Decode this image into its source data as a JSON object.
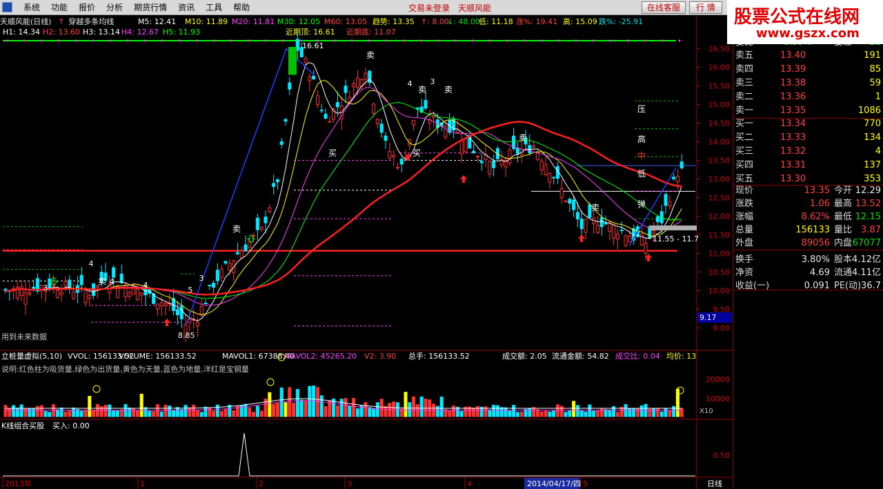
{
  "menubar": {
    "items": [
      "系统",
      "功能",
      "报价",
      "分析",
      "期货行情",
      "资讯",
      "工具",
      "帮助"
    ],
    "login_status": "交易未登录",
    "brand": "天顺风能",
    "btn_service": "在线客服",
    "btn_quote": "行 情"
  },
  "watermark": {
    "title": "股票公式在线网",
    "url": "www.gszx.com"
  },
  "header": {
    "stock": "天顺风能(日线)",
    "indicator_name": "穿越多条均线",
    "ma": [
      {
        "label": "M5: 12.41",
        "color": "#ffffff"
      },
      {
        "label": "M10: 11.89",
        "color": "#ffff00"
      },
      {
        "label": "M20: 11.81",
        "color": "#ff40ff"
      },
      {
        "label": "M30: 12.05",
        "color": "#00ff00"
      },
      {
        "label": "M60: 13.05",
        "color": "#ff4040"
      }
    ],
    "trend": {
      "label": "趋势: 13.35",
      "color": "#ffff00"
    },
    "extra": [
      {
        "label": "↑: 8.00",
        "color": "#ff4040"
      },
      {
        "label": "↓: 48.00",
        "color": "#00e000"
      },
      {
        "label": "低: 11.18",
        "color": "#ffff00"
      },
      {
        "label": "涨%: 19.41",
        "color": "#ff4040"
      },
      {
        "label": "高: 15.09",
        "color": "#ffff00"
      },
      {
        "label": "跌%: -25.91",
        "color": "#00e0e0"
      }
    ],
    "h_levels": [
      {
        "label": "H1: 14.34",
        "color": "#ffffff"
      },
      {
        "label": "H2: 13.60",
        "color": "#ff4040"
      },
      {
        "label": "H3: 13.14",
        "color": "#ffffff"
      },
      {
        "label": "H4: 12.67",
        "color": "#ff40ff"
      },
      {
        "label": "H5: 11.93",
        "color": "#00ff00"
      }
    ],
    "recent_top": "近期顶: 16.61",
    "recent_bottom": "近期底: 11.07"
  },
  "chart_data": {
    "type": "candlestick",
    "price_axis": {
      "ticks": [
        "16.50",
        "16.00",
        "15.50",
        "15.00",
        "14.50",
        "14.00",
        "13.50",
        "13.00",
        "12.50",
        "12.00",
        "11.50",
        "11.00",
        "10.50",
        "10.00",
        "9.50",
        "9.00"
      ],
      "min": 8.95,
      "max": 16.68
    },
    "current_price_label": "9.17",
    "top_label": "16.61",
    "bottom_label": "8.85",
    "range_label": "11.55 - 11.7",
    "signal_labels": [
      "卖",
      "卖",
      "卖",
      "卖",
      "卖",
      "卖",
      "卖",
      "买",
      "买",
      "压",
      "高",
      "中",
      "低",
      "弹"
    ],
    "count_labels": [
      "3",
      "4",
      "4",
      "4",
      "5",
      "3",
      "4",
      "3"
    ],
    "future_note": "用到未来数据",
    "volume_panel": {
      "title": "立桩量虚拟(5,10)",
      "items": [
        {
          "label": "VVOL: 156133.52",
          "color": "#ffffff"
        },
        {
          "label": "VOLUME: 156133.52",
          "color": "#ffffff"
        },
        {
          "label": "MAVOL1: 67388.40",
          "color": "#ffffff"
        },
        {
          "label": "MAVOL2: 45265.20",
          "color": "#ff40ff"
        },
        {
          "label": "V2: 3.90",
          "color": "#ff4040"
        },
        {
          "label": "总手: 156133.52",
          "color": "#ffffff"
        },
        {
          "label": "成交额: 2.05",
          "color": "#ffffff"
        },
        {
          "label": "流通金额: 54.82",
          "color": "#ffffff"
        },
        {
          "label": "成交比: 0.04",
          "color": "#ff40ff"
        },
        {
          "label": "均价: 13",
          "color": "#ffff00"
        }
      ],
      "note": "说明:红色柱为吸货量,绿色为出货量,黄色为天量,蓝色为地量,洋红是宝钢量",
      "ticks": [
        "20000",
        "10000"
      ],
      "multiplier": "X10"
    },
    "kline_panel": {
      "title": "K线组合买股",
      "buy_label": "买入: 0.00",
      "ticks": [
        "0.50"
      ],
      "spike_index": 60
    },
    "x_axis": {
      "labels": [
        "2013年",
        "1",
        "2",
        "3",
        "4",
        "5"
      ],
      "cursor_date": "2014/04/17/四",
      "period": "日线"
    }
  },
  "orderbook": {
    "partial_top": {
      "label": "委比",
      "price": "-8.39%",
      "label2": "委差",
      "vol": "-28"
    },
    "sells": [
      {
        "label": "卖五",
        "price": "13.40",
        "vol": "191"
      },
      {
        "label": "卖四",
        "price": "13.39",
        "vol": "85"
      },
      {
        "label": "卖三",
        "price": "13.38",
        "vol": "59"
      },
      {
        "label": "卖二",
        "price": "13.36",
        "vol": "1"
      },
      {
        "label": "卖一",
        "price": "13.35",
        "vol": "1086"
      }
    ],
    "buys": [
      {
        "label": "买一",
        "price": "13.34",
        "vol": "770"
      },
      {
        "label": "买二",
        "price": "13.33",
        "vol": "134"
      },
      {
        "label": "买三",
        "price": "13.32",
        "vol": "4"
      },
      {
        "label": "买四",
        "price": "13.31",
        "vol": "137"
      },
      {
        "label": "买五",
        "price": "13.30",
        "vol": "353"
      }
    ]
  },
  "stats": [
    {
      "l1": "现价",
      "v1": "13.35",
      "c1": "red",
      "l2": "今开",
      "v2": "12.29",
      "c2": "wht"
    },
    {
      "l1": "涨跌",
      "v1": "1.06",
      "c1": "red",
      "l2": "最高",
      "v2": "13.52",
      "c2": "red"
    },
    {
      "l1": "涨幅",
      "v1": "8.62%",
      "c1": "red",
      "l2": "最低",
      "v2": "12.15",
      "c2": "grn"
    },
    {
      "l1": "总量",
      "v1": "156133",
      "c1": "yel",
      "l2": "量比",
      "v2": "3.87",
      "c2": "red"
    },
    {
      "l1": "外盘",
      "v1": "89056",
      "c1": "red",
      "l2": "内盘",
      "v2": "67077",
      "c2": "grn"
    },
    {
      "l1": "换手",
      "v1": "3.80%",
      "c1": "wht",
      "l2": "股本",
      "v2": "4.12亿",
      "c2": "wht"
    },
    {
      "l1": "净资",
      "v1": "4.69",
      "c1": "wht",
      "l2": "流通",
      "v2": "4.11亿",
      "c2": "wht"
    },
    {
      "l1": "收益(一)",
      "v1": "0.091",
      "c1": "wht",
      "l2": "PE(动)",
      "v2": "36.7",
      "c2": "wht"
    }
  ]
}
